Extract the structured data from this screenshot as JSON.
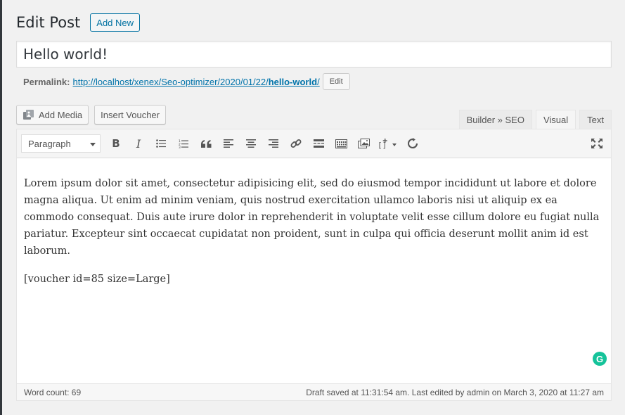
{
  "header": {
    "title": "Edit Post",
    "add_new": "Add New"
  },
  "post": {
    "title": "Hello world!"
  },
  "permalink": {
    "label": "Permalink:",
    "url_prefix": "http://localhost/xenex/Seo-optimizer/2020/01/22/",
    "slug": "hello-world",
    "url_suffix": "/",
    "edit": "Edit"
  },
  "media": {
    "add_media": "Add Media",
    "insert_voucher": "Insert Voucher"
  },
  "tabs": [
    {
      "label": "Builder » SEO"
    },
    {
      "label": "Visual"
    },
    {
      "label": "Text"
    }
  ],
  "toolbar": {
    "format": "Paragraph"
  },
  "content": {
    "paragraphs": [
      "Lorem ipsum dolor sit amet, consectetur adipisicing elit, sed do eiusmod tempor incididunt ut labore et dolore magna aliqua. Ut enim ad minim veniam, quis nostrud exercitation ullamco laboris nisi ut aliquip ex ea commodo consequat. Duis aute irure dolor in reprehenderit in voluptate velit esse cillum dolore eu fugiat nulla pariatur. Excepteur sint occaecat cupidatat non proident, sunt in culpa qui officia deserunt mollit anim id est laborum.",
      "[voucher id=85 size=Large]"
    ]
  },
  "status": {
    "word_count": "Word count: 69",
    "saved": "Draft saved at 11:31:54 am. Last edited by admin on March 3, 2020 at 11:27 am"
  },
  "icons": [
    "bold-icon",
    "italic-icon",
    "bullet-list-icon",
    "numbered-list-icon",
    "blockquote-icon",
    "align-left-icon",
    "align-center-icon",
    "align-right-icon",
    "link-icon",
    "read-more-icon",
    "toolbar-toggle-icon",
    "media-gallery-icon",
    "shortcode-icon",
    "refresh-icon",
    "fullscreen-icon",
    "grammarly-icon"
  ],
  "colors": {
    "link": "#0073aa",
    "grammarly": "#15c39a"
  }
}
